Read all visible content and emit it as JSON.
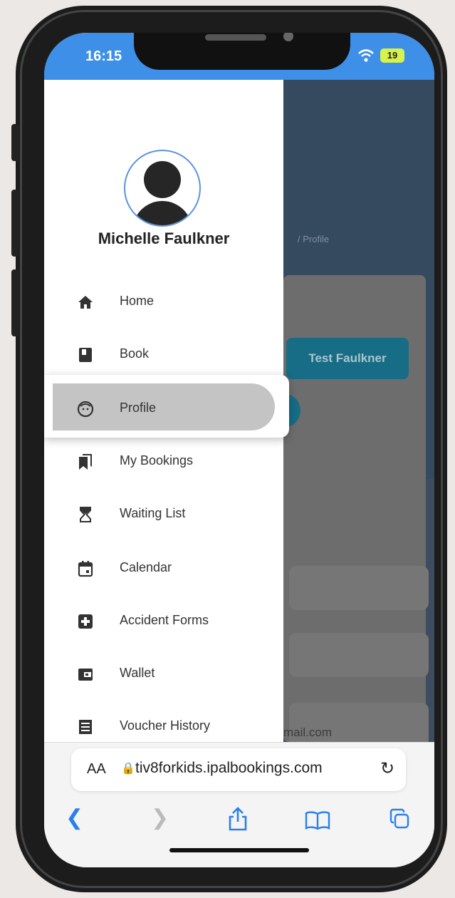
{
  "status_bar": {
    "time": "16:15",
    "battery": "19"
  },
  "user": {
    "name": "Michelle Faulkner"
  },
  "menu": {
    "items": [
      {
        "label": "Home",
        "icon": "home-icon"
      },
      {
        "label": "Book",
        "icon": "book-icon"
      },
      {
        "label": "Profile",
        "icon": "face-icon",
        "selected": true
      },
      {
        "label": "My Bookings",
        "icon": "bookmarks-icon"
      },
      {
        "label": "Waiting List",
        "icon": "hourglass-icon"
      },
      {
        "label": "Calendar",
        "icon": "calendar-icon"
      },
      {
        "label": "Accident Forms",
        "icon": "medical-plus-icon"
      },
      {
        "label": "Wallet",
        "icon": "wallet-icon"
      },
      {
        "label": "Voucher History",
        "icon": "receipt-icon"
      }
    ]
  },
  "background_page": {
    "breadcrumb": "/  Profile",
    "child_button": "Test Faulkner",
    "email_fragment": "mail.com"
  },
  "browser": {
    "text_size_label": "AA",
    "url": "tiv8forkids.ipalbookings.com"
  },
  "colors": {
    "accent": "#3d8fe8",
    "selected_pill": "#c4c4c4"
  }
}
